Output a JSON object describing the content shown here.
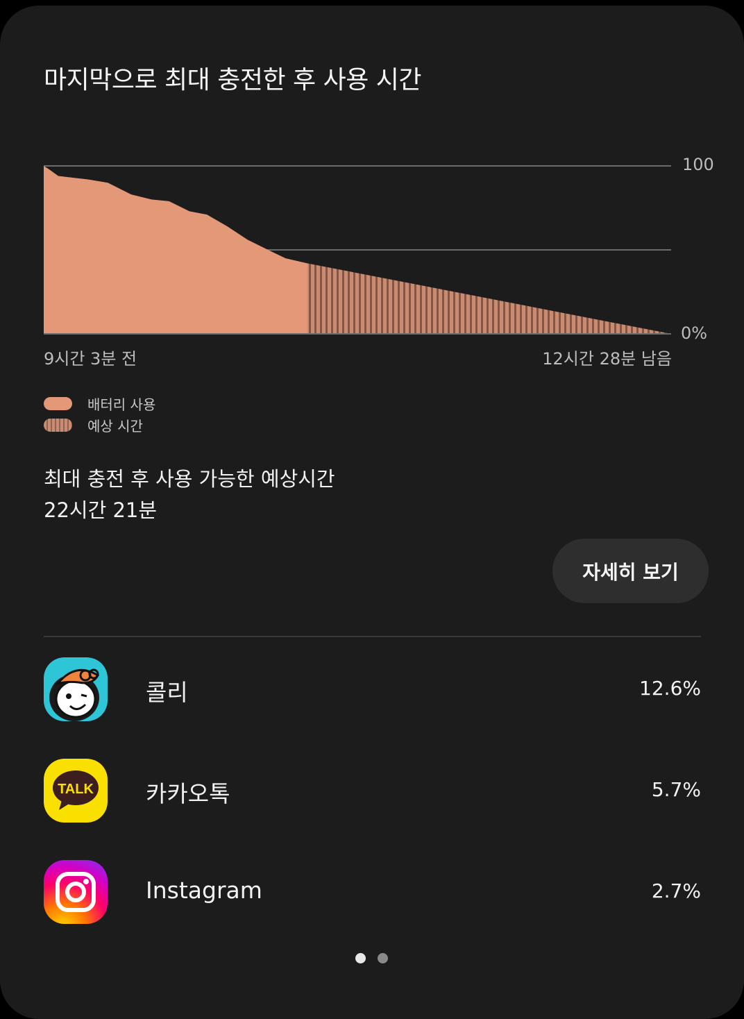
{
  "title": "마지막으로 최대 충전한 후 사용 시간",
  "chart": {
    "y_top_label": "100",
    "y_bottom_label": "0%",
    "x_left_label": "9시간 3분 전",
    "x_right_label": "12시간 28분 남음"
  },
  "legend": {
    "usage_label": "배터리 사용",
    "estimate_label": "예상 시간"
  },
  "summary": {
    "label": "최대 충전 후 사용 가능한 예상시간",
    "value": "22시간 21분"
  },
  "details_button": "자세히 보기",
  "apps": [
    {
      "name": "콜리",
      "percent": "12.6%",
      "icon": "kolly-app-icon"
    },
    {
      "name": "카카오톡",
      "percent": "5.7%",
      "icon": "kakaotalk-app-icon",
      "icon_text": "TALK"
    },
    {
      "name": "Instagram",
      "percent": "2.7%",
      "icon": "instagram-app-icon"
    }
  ],
  "colors": {
    "usage": "#e39878",
    "estimate": "#c98c72",
    "card_background": "#1c1c1c",
    "button_background": "#2e2e2e"
  },
  "chart_data": {
    "type": "area",
    "x_unit": "hours since full charge",
    "ylim": [
      0,
      100
    ],
    "y_ticks": [
      0,
      50,
      100
    ],
    "now_x": 9.05,
    "usage": {
      "name": "배터리 사용",
      "x": [
        0,
        0.18,
        0.5,
        1.0,
        1.5,
        2.2,
        3.0,
        3.7,
        4.3,
        5.0,
        5.6,
        6.3,
        7.0,
        7.7,
        8.3,
        9.05
      ],
      "y": [
        100,
        98,
        94,
        93,
        92,
        90,
        83,
        80,
        79,
        73,
        71,
        64,
        56,
        50,
        45,
        42
      ]
    },
    "estimate": {
      "name": "예상 시간",
      "x": [
        9.05,
        21.53
      ],
      "y": [
        42,
        0
      ]
    },
    "x_total": 21.53
  }
}
